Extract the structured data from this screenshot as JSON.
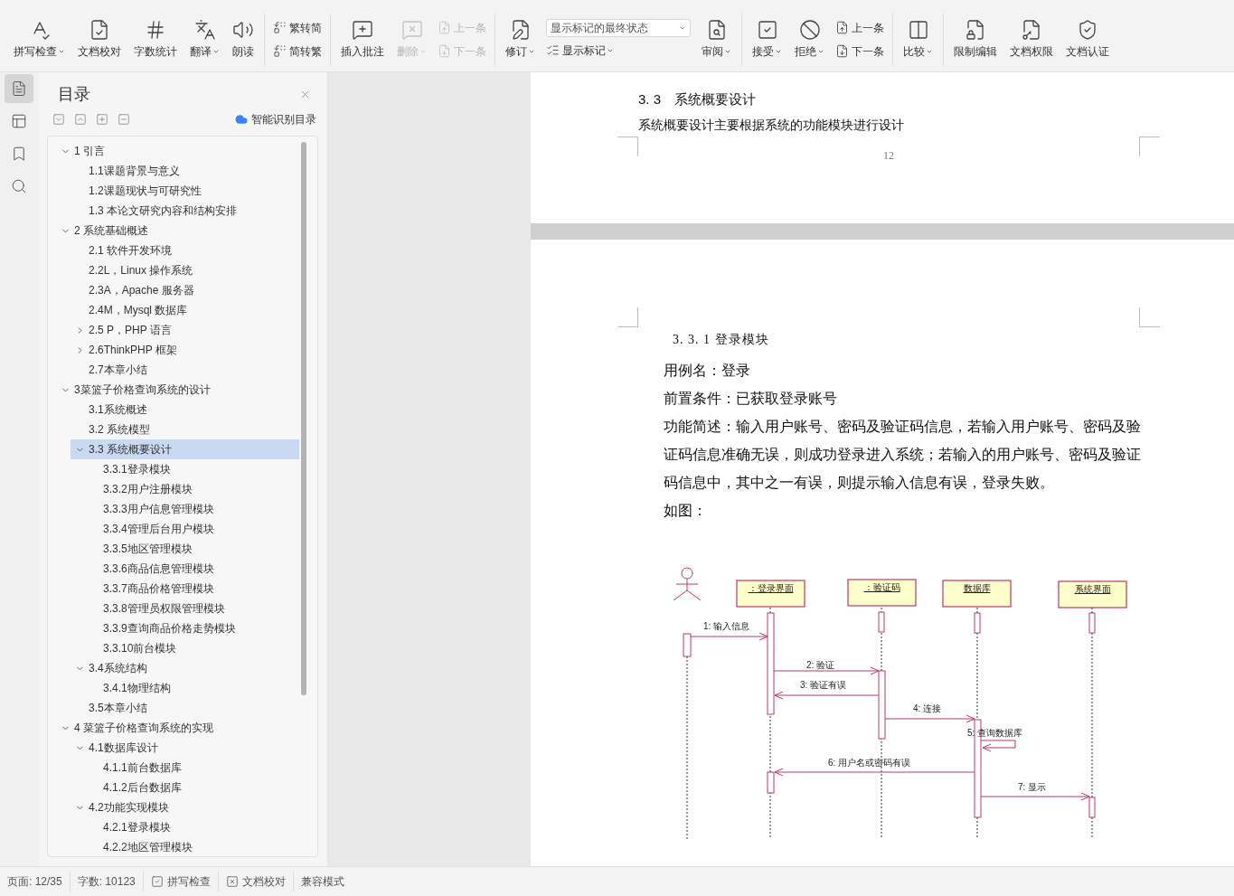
{
  "ribbon": [
    [
      {
        "kind": "large",
        "label": "拼写检查",
        "dropdown": true,
        "disabled": false
      },
      {
        "kind": "large",
        "label": "文档校对",
        "dropdown": false,
        "disabled": false
      },
      {
        "kind": "large",
        "label": "字数统计",
        "dropdown": false,
        "disabled": false
      },
      {
        "kind": "large",
        "label": "翻译",
        "dropdown": true,
        "disabled": false
      },
      {
        "kind": "large",
        "label": "朗读",
        "dropdown": false,
        "disabled": false
      }
    ],
    [
      {
        "kind": "small",
        "label": "繁转简",
        "dropdown": false,
        "disabled": false
      },
      {
        "kind": "small",
        "label": "简转繁",
        "dropdown": false,
        "disabled": false
      }
    ],
    [
      {
        "kind": "large",
        "label": "插入批注",
        "dropdown": false,
        "disabled": false
      },
      {
        "kind": "large",
        "label": "删除",
        "dropdown": true,
        "disabled": true
      },
      {
        "kind": "small",
        "label": "上一条",
        "dropdown": false,
        "disabled": true
      },
      {
        "kind": "small",
        "label": "下一条",
        "dropdown": false,
        "disabled": true
      }
    ],
    [
      {
        "kind": "large",
        "label": "修订",
        "dropdown": true,
        "disabled": false
      },
      {
        "kind": "select",
        "value": "显示标记的最终状态"
      },
      {
        "kind": "small",
        "label": "显示标记",
        "dropdown": true,
        "disabled": false
      },
      {
        "kind": "large",
        "label": "审阅",
        "dropdown": true,
        "disabled": false
      }
    ],
    [
      {
        "kind": "large",
        "label": "接受",
        "dropdown": true,
        "disabled": false
      },
      {
        "kind": "large",
        "label": "拒绝",
        "dropdown": true,
        "disabled": false
      },
      {
        "kind": "small",
        "label": "上一条",
        "dropdown": false,
        "disabled": false
      },
      {
        "kind": "small",
        "label": "下一条",
        "dropdown": false,
        "disabled": false
      }
    ],
    [
      {
        "kind": "large",
        "label": "比较",
        "dropdown": true,
        "disabled": false
      }
    ],
    [
      {
        "kind": "large",
        "label": "限制编辑",
        "dropdown": false,
        "disabled": false
      },
      {
        "kind": "large",
        "label": "文档权限",
        "dropdown": false,
        "disabled": false
      },
      {
        "kind": "large",
        "label": "文档认证",
        "dropdown": false,
        "disabled": false
      }
    ]
  ],
  "side_rail": [
    {
      "selected": true
    },
    {
      "selected": false
    },
    {
      "selected": false
    },
    {
      "selected": false
    }
  ],
  "toc_panel": {
    "title": "目录",
    "smart_button": "智能识别目录",
    "items": [
      {
        "label": "1  引言",
        "selected": false,
        "expanded": true,
        "children": [
          {
            "label": "1.1课题背景与意义",
            "selected": false
          },
          {
            "label": "1.2课题现状与可研究性",
            "selected": false
          },
          {
            "label": "1.3  本论文研究内容和结构安排",
            "selected": false
          }
        ]
      },
      {
        "label": "2  系统基础概述",
        "selected": false,
        "expanded": true,
        "children": [
          {
            "label": "2.1  软件开发环境",
            "selected": false
          },
          {
            "label": "2.2L，Linux 操作系统",
            "selected": false
          },
          {
            "label": "2.3A，Apache 服务器",
            "selected": false
          },
          {
            "label": "2.4M，Mysql 数据库",
            "selected": false
          },
          {
            "label": "2.5  P，PHP 语言",
            "selected": false,
            "expanded": false
          },
          {
            "label": "2.6ThinkPHP 框架",
            "selected": false,
            "expanded": false
          },
          {
            "label": "2.7本章小结",
            "selected": false
          }
        ]
      },
      {
        "label": "3菜篮子价格查询系统的设计",
        "selected": false,
        "expanded": true,
        "children": [
          {
            "label": "3.1系统概述",
            "selected": false
          },
          {
            "label": "3.2  系统模型",
            "selected": false
          },
          {
            "label": "3.3  系统概要设计",
            "selected": true,
            "expanded": true,
            "children": [
              {
                "label": "3.3.1登录模块",
                "selected": false
              },
              {
                "label": "3.3.2用户注册模块",
                "selected": false
              },
              {
                "label": "3.3.3用户信息管理模块",
                "selected": false
              },
              {
                "label": "3.3.4管理后台用户模块",
                "selected": false
              },
              {
                "label": "3.3.5地区管理模块",
                "selected": false
              },
              {
                "label": "3.3.6商品信息管理模块",
                "selected": false
              },
              {
                "label": "3.3.7商品价格管理模块",
                "selected": false
              },
              {
                "label": "3.3.8管理员权限管理模块",
                "selected": false
              },
              {
                "label": "3.3.9查询商品价格走势模块",
                "selected": false
              },
              {
                "label": "3.3.10前台模块",
                "selected": false
              }
            ]
          },
          {
            "label": "3.4系统结构",
            "selected": false,
            "expanded": true,
            "children": [
              {
                "label": "3.4.1物理结构",
                "selected": false
              }
            ]
          },
          {
            "label": "3.5本章小结",
            "selected": false
          }
        ]
      },
      {
        "label": "4  菜篮子价格查询系统的实现",
        "selected": false,
        "expanded": true,
        "children": [
          {
            "label": "4.1数据库设计",
            "selected": false,
            "expanded": true,
            "children": [
              {
                "label": "4.1.1前台数据库",
                "selected": false
              },
              {
                "label": "4.1.2后台数据库",
                "selected": false
              }
            ]
          },
          {
            "label": "4.2功能实现模块",
            "selected": false,
            "expanded": true,
            "children": [
              {
                "label": "4.2.1登录模块",
                "selected": false
              },
              {
                "label": "4.2.2地区管理模块",
                "selected": false
              }
            ]
          }
        ]
      }
    ]
  },
  "page_1": {
    "heading": "3. 3　系统概要设计",
    "paragraph": "系统概要设计主要根据系统的功能模块进行设计",
    "page_number": "12"
  },
  "page_2": {
    "heading": "3. 3. 1 登录模块",
    "paragraphs": [
      "用例名：登录",
      "前置条件：已获取登录账号",
      "功能简述：输入用户账号、密码及验证码信息，若输入用户账号、密码及验证码信息准确无误，则成功登录进入系统；若输入的用户账号、密码及验证码信息中，其中之一有误，则提示输入信息有误，登录失败。",
      "如图："
    ],
    "sequence_diagram": {
      "lifelines": [
        {
          "label": "：登录界面"
        },
        {
          "label": "：验证码"
        },
        {
          "label": "数据库"
        },
        {
          "label": "系统界面"
        }
      ],
      "messages": [
        {
          "label": "1: 输入信息"
        },
        {
          "label": "2: 验证"
        },
        {
          "label": "3: 验证有误"
        },
        {
          "label": "4: 连接"
        },
        {
          "label": "5: 查询数据库"
        },
        {
          "label": "6: 用户名或密码有误"
        },
        {
          "label": "7: 显示"
        }
      ]
    }
  },
  "status_bar": [
    {
      "kind": "text",
      "label": "页面: 12/35"
    },
    {
      "kind": "text",
      "label": "字数: 10123"
    },
    {
      "kind": "check",
      "label": "拼写检查"
    },
    {
      "kind": "cross",
      "label": "文档校对"
    },
    {
      "kind": "text",
      "label": "兼容模式"
    }
  ]
}
